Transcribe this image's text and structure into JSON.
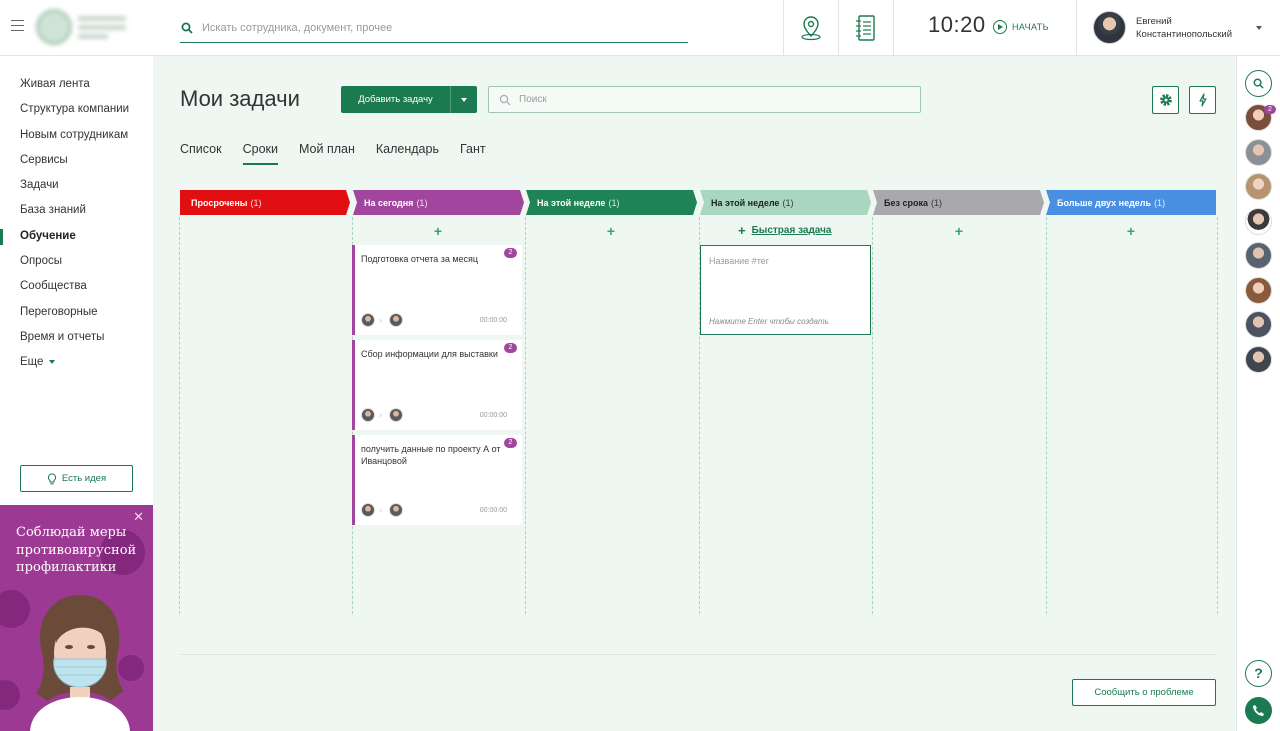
{
  "header": {
    "search_placeholder": "Искать сотрудника, документ, прочее",
    "time": "10:20",
    "start_label": "НАЧАТЬ",
    "user_first": "Евгений",
    "user_last": "Константинопольский"
  },
  "sidebar": {
    "items": [
      {
        "label": "Живая лента"
      },
      {
        "label": "Структура компании"
      },
      {
        "label": "Новым сотрудникам"
      },
      {
        "label": "Сервисы"
      },
      {
        "label": "Задачи"
      },
      {
        "label": "База знаний"
      },
      {
        "label": "Обучение",
        "active": true
      },
      {
        "label": "Опросы"
      },
      {
        "label": "Сообщества"
      },
      {
        "label": "Переговорные"
      },
      {
        "label": "Время и отчеты"
      },
      {
        "label": "Еще"
      }
    ],
    "idea_button": "Есть идея",
    "promo_text": "Соблюдай меры противовирусной профилактики"
  },
  "page": {
    "title": "Мои задачи",
    "add_task": "Добавить задачу",
    "search_placeholder": "Поиск",
    "tabs": [
      {
        "label": "Список"
      },
      {
        "label": "Сроки",
        "active": true
      },
      {
        "label": "Мой план"
      },
      {
        "label": "Календарь"
      },
      {
        "label": "Гант"
      }
    ],
    "quick_task": "Быстрая задача",
    "new_task_placeholder": "Название #тег",
    "new_task_hint": "Нажмите Enter чтобы создать",
    "report_button": "Сообщить о проблеме"
  },
  "columns": [
    {
      "title": "Просрочены",
      "count": "(1)",
      "color": "#e10f11",
      "text_color": "#ffffff"
    },
    {
      "title": "На сегодня",
      "count": "(1)",
      "color": "#a2459e",
      "text_color": "#ffffff"
    },
    {
      "title": "На этой  неделе",
      "count": "(1)",
      "color": "#1e8456",
      "text_color": "#ffffff"
    },
    {
      "title": "На этой  неделе",
      "count": "(1)",
      "color": "#a9d6bf",
      "text_color": "#222222"
    },
    {
      "title": "Без срока",
      "count": "(1)",
      "color": "#a8a8ad",
      "text_color": "#222222"
    },
    {
      "title": "Больше двух недель",
      "count": "(1)",
      "color": "#4a90e2",
      "text_color": "#ffffff"
    }
  ],
  "tasks": [
    {
      "title": "Подготовка отчета за месяц",
      "badge": "2",
      "time": "00:00:00"
    },
    {
      "title": "Сбор информации для выставки",
      "badge": "2",
      "time": "00:00:00"
    },
    {
      "title": "получить данные по проекту А от Иванцовой",
      "badge": "2",
      "time": "00:00:00"
    }
  ],
  "right_panel": {
    "badge": "2",
    "help": "?"
  }
}
